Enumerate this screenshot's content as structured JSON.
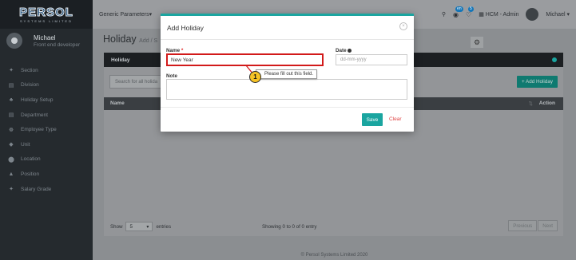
{
  "brand": {
    "logo_text": "PERSOL",
    "logo_sub": "SYSTEMS LIMITED"
  },
  "user": {
    "name": "Michael",
    "role": "Front end developer"
  },
  "sidebar": {
    "items": [
      {
        "label": "Section",
        "icon": "pin-icon",
        "glyph": "✦"
      },
      {
        "label": "Division",
        "icon": "document-icon",
        "glyph": "▤"
      },
      {
        "label": "Holiday Setup",
        "icon": "person-icon",
        "glyph": "♣"
      },
      {
        "label": "Department",
        "icon": "document-icon",
        "glyph": "▤"
      },
      {
        "label": "Employee Type",
        "icon": "people-icon",
        "glyph": "☸"
      },
      {
        "label": "Unit",
        "icon": "tag-icon",
        "glyph": "◆"
      },
      {
        "label": "Location",
        "icon": "map-marker-icon",
        "glyph": "⬤"
      },
      {
        "label": "Position",
        "icon": "graduation-cap-icon",
        "glyph": "▲"
      },
      {
        "label": "Salary Grade",
        "icon": "pin-icon",
        "glyph": "✦"
      }
    ]
  },
  "topbar": {
    "params_label": "Generic Parameters",
    "dropdown_caret": "▾",
    "lang_badge": "en",
    "notif_count": "5",
    "hcm_label": "HCM - Admin",
    "user_menu": "Michael",
    "caret": "▾"
  },
  "page": {
    "title": "Holiday",
    "subtitle": "Add / S"
  },
  "card": {
    "header": "Holiday",
    "search_placeholder": "Search for all holida",
    "add_button": "+ Add Holiday",
    "columns": {
      "name": "Name",
      "sort": "⇅",
      "action": "Action"
    },
    "footer": {
      "show_label": "Show",
      "page_size": "5",
      "entries_label": "entries",
      "showing": "Showing 0 to 0 of 0 entry",
      "previous": "Previous",
      "next": "Next"
    }
  },
  "footer_text": "© Persol Systems Limited 2020",
  "modal": {
    "title": "Add Holiday",
    "close_glyph": "×",
    "name_label": "Name",
    "required_mark": "*",
    "name_value": "New Year",
    "date_label": "Date",
    "date_placeholder": "dd-mm-yyyy",
    "note_label": "Note",
    "save_button": "Save",
    "clear_button": "Clear"
  },
  "tooltip": {
    "text": "Please fill out this field."
  },
  "annotation": {
    "number": "1"
  },
  "colors": {
    "accent": "#1aa5a0",
    "error": "#d21a1a",
    "callout": "#f7c325"
  }
}
